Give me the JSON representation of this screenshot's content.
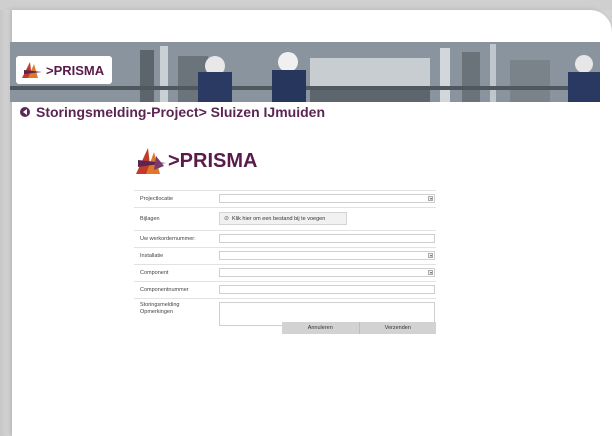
{
  "banner": {
    "brand": ">PRISMA"
  },
  "page": {
    "title": "Storingsmelding-Project> Sluizen IJmuiden"
  },
  "form": {
    "brand": ">PRISMA",
    "fields": {
      "projectlocatie": {
        "label": "Projectlocatie",
        "value": ""
      },
      "bijlagen": {
        "label": "Bijlagen",
        "button": "Klik hier om een bestand bij te voegen"
      },
      "werkordernummer": {
        "label": "Uw werkordernummer:",
        "value": ""
      },
      "installatie": {
        "label": "Installatie",
        "value": ""
      },
      "component": {
        "label": "Component",
        "value": ""
      },
      "componentnummer": {
        "label": "Componentnummer",
        "value": ""
      },
      "opmerkingen": {
        "label": "Storingsmelding Opmerkingen",
        "value": ""
      }
    },
    "actions": {
      "cancel": "Annuleren",
      "submit": "Verzenden"
    }
  },
  "colors": {
    "brand_purple": "#5b2552",
    "accent_orange": "#e0782a"
  }
}
